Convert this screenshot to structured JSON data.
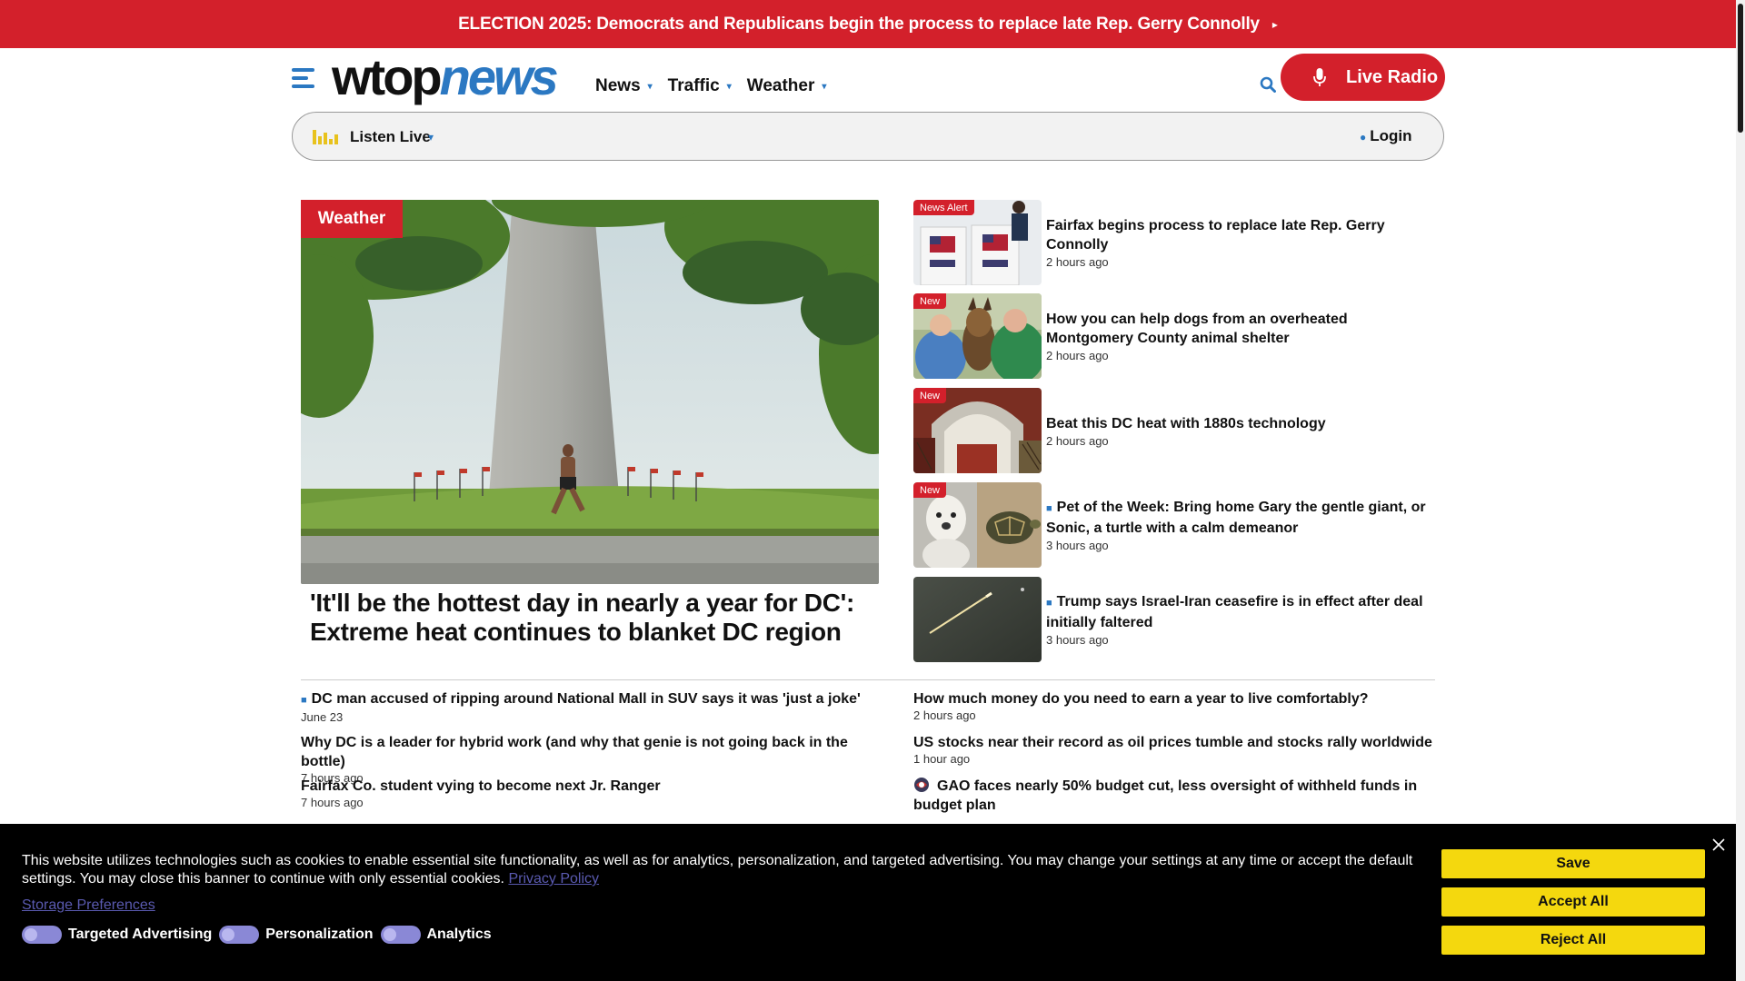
{
  "alert": {
    "text": "ELECTION 2025: Democrats and Republicans begin the process to replace late Rep. Gerry Connolly",
    "chevron": "▸"
  },
  "header": {
    "logo_part1": "wtop",
    "logo_part2": "news",
    "nav": [
      "News",
      "Traffic",
      "Weather"
    ],
    "live_radio": "Live Radio",
    "icons": {
      "menu": "hamburger-icon",
      "search": "search-icon",
      "mic": "microphone-icon"
    }
  },
  "listen_bar": {
    "label": "Listen Live",
    "login": "Login"
  },
  "hero": {
    "tag": "Weather",
    "title": "'It'll be the hottest day in nearly a year for DC': Extreme heat continues to blanket DC region"
  },
  "side_stories": [
    {
      "badge": "News Alert",
      "title": "Fairfax begins process to replace late Rep. Gerry Connolly",
      "time": "2 hours ago"
    },
    {
      "badge": "New",
      "title": "How you can help dogs from an overheated Montgomery County animal shelter",
      "time": "2 hours ago"
    },
    {
      "badge": "New",
      "title": "Beat this DC heat with 1880s technology",
      "time": "2 hours ago"
    },
    {
      "badge": "New",
      "title": "Pet of the Week: Bring home Gary the gentle giant, or Sonic, a turtle with a calm demeanor",
      "time": "3 hours ago"
    },
    {
      "badge": "",
      "title": "Trump says Israel-Iran ceasefire is in effect after deal initially faltered",
      "time": "3 hours ago"
    }
  ],
  "list_left": [
    {
      "title": "DC man accused of ripping around National Mall in SUV says it was 'just a joke'",
      "time": "June 23"
    },
    {
      "title": "Why DC is a leader for hybrid work (and why that genie is not going back in the bottle)",
      "time": "7 hours ago"
    },
    {
      "title": "Fairfax Co. student vying to become next Jr. Ranger",
      "time": "7 hours ago"
    }
  ],
  "list_right": [
    {
      "title": "How much money do you need to earn a year to live comfortably?",
      "time": "2 hours ago"
    },
    {
      "title": "US stocks near their record as oil prices tumble and stocks rally worldwide",
      "time": "1 hour ago"
    },
    {
      "title": "GAO faces nearly 50% budget cut, less oversight of withheld funds in budget plan",
      "time": ""
    }
  ],
  "cookie": {
    "message": "This website utilizes technologies such as cookies to enable essential site functionality, as well as for analytics, personalization, and targeted advertising. You may change your settings at any time or accept the default settings. You may close this banner to continue with only essential cookies.",
    "privacy_link": "Privacy Policy",
    "storage_link": "Storage Preferences",
    "toggles": [
      "Targeted Advertising",
      "Personalization",
      "Analytics"
    ],
    "buttons": {
      "save": "Save",
      "accept": "Accept All",
      "reject": "Reject All"
    }
  },
  "colors": {
    "brand_red": "#d3202b",
    "brand_blue": "#2b78c2",
    "cookie_yellow": "#f4d80e"
  }
}
